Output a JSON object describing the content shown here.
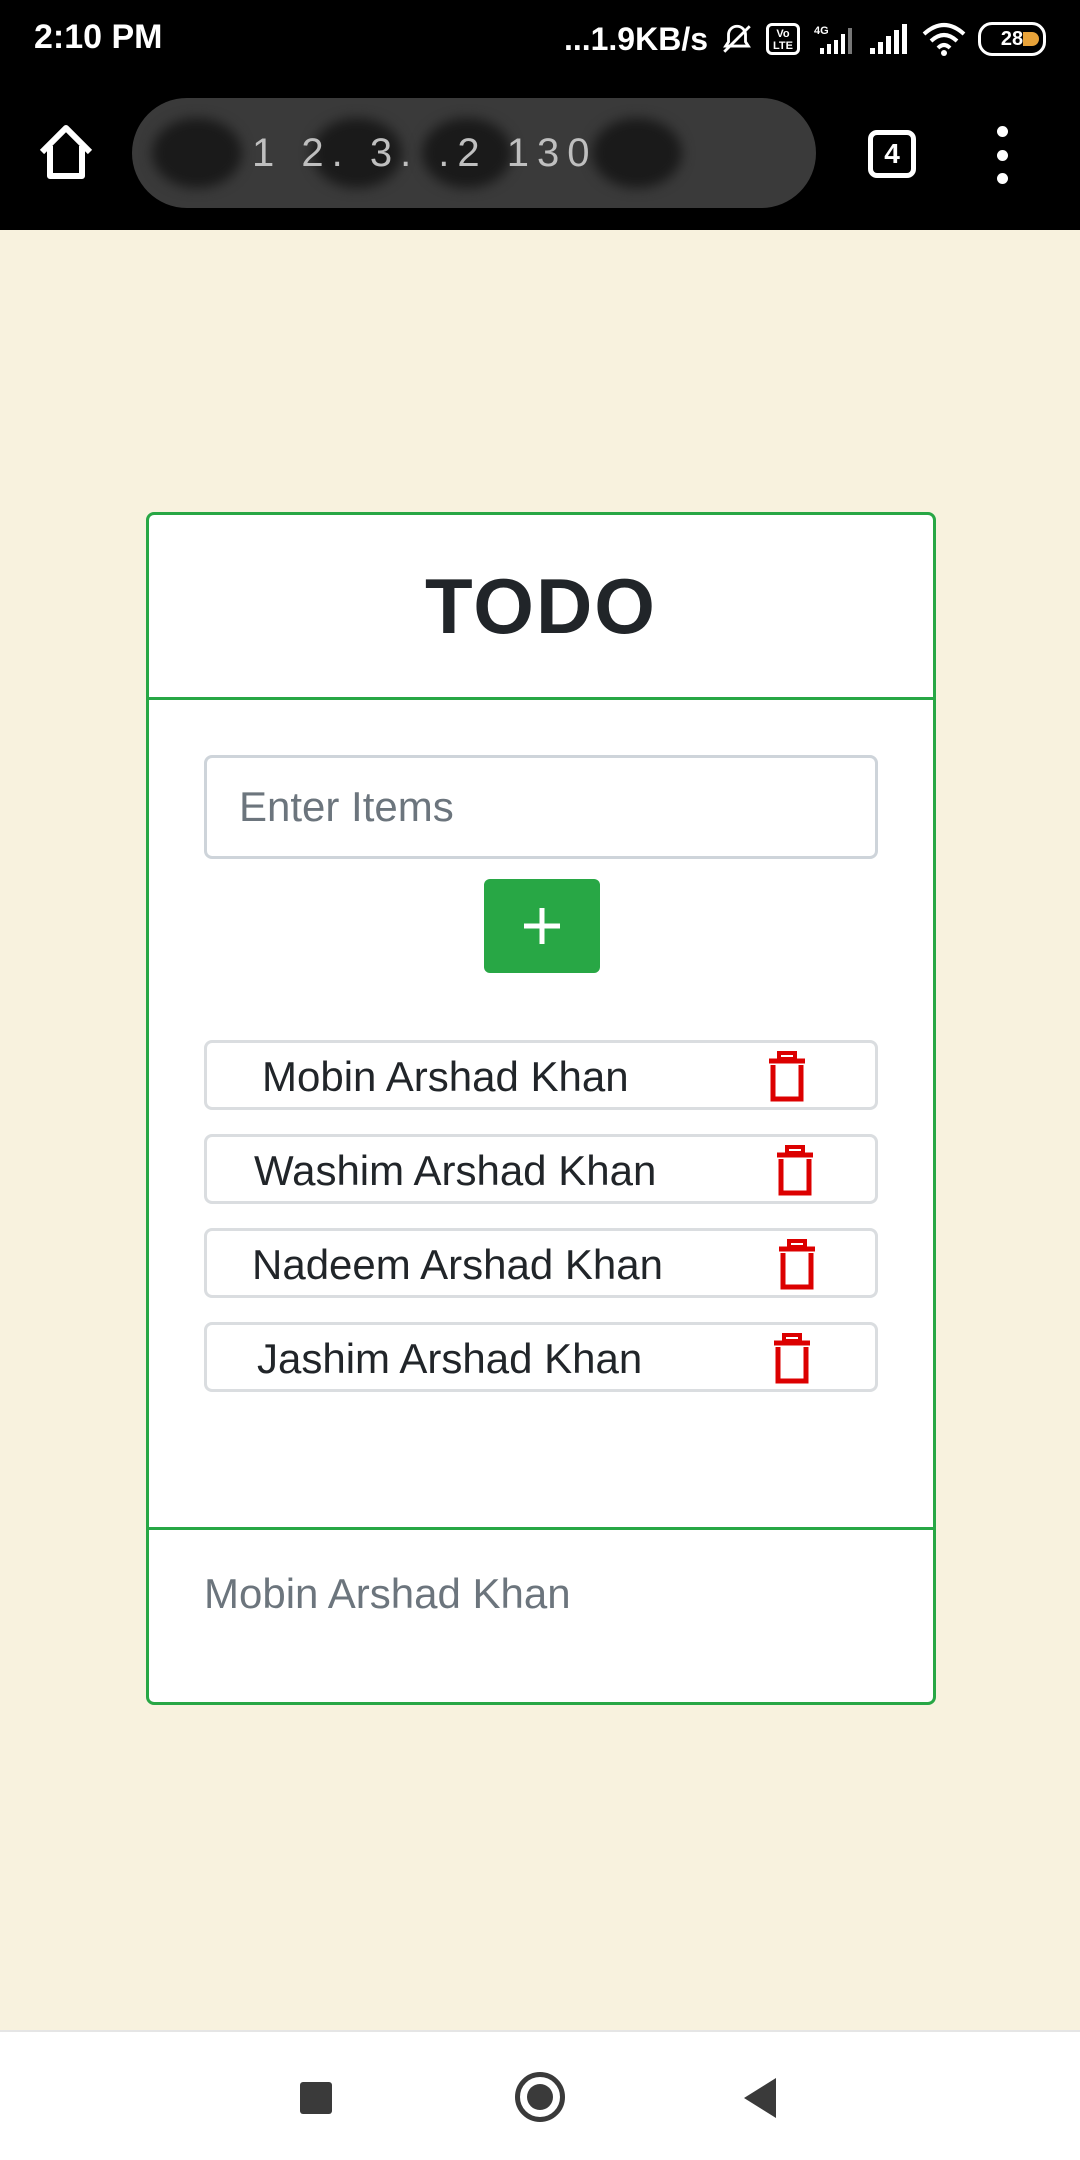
{
  "status_bar": {
    "time": "2:10 PM",
    "network_speed": "...1.9KB/s",
    "battery": "28",
    "icons": [
      "mute-icon",
      "volte-icon",
      "signal-4g-icon",
      "signal-icon",
      "wifi-icon",
      "battery-icon"
    ]
  },
  "browser": {
    "url": "1 2. 3. .2 130",
    "tab_count": "4"
  },
  "todo": {
    "title": "TODO",
    "input_placeholder": "Enter Items",
    "add_label": "+",
    "items": [
      {
        "text": "Mobin Arshad Khan"
      },
      {
        "text": "Washim Arshad Khan"
      },
      {
        "text": "Nadeem Arshad Khan"
      },
      {
        "text": "Jashim Arshad Khan"
      }
    ],
    "footer": "Mobin Arshad Khan"
  },
  "colors": {
    "page_bg": "#f8f2de",
    "accent_green": "#28a745",
    "delete_red": "#dc0000"
  }
}
